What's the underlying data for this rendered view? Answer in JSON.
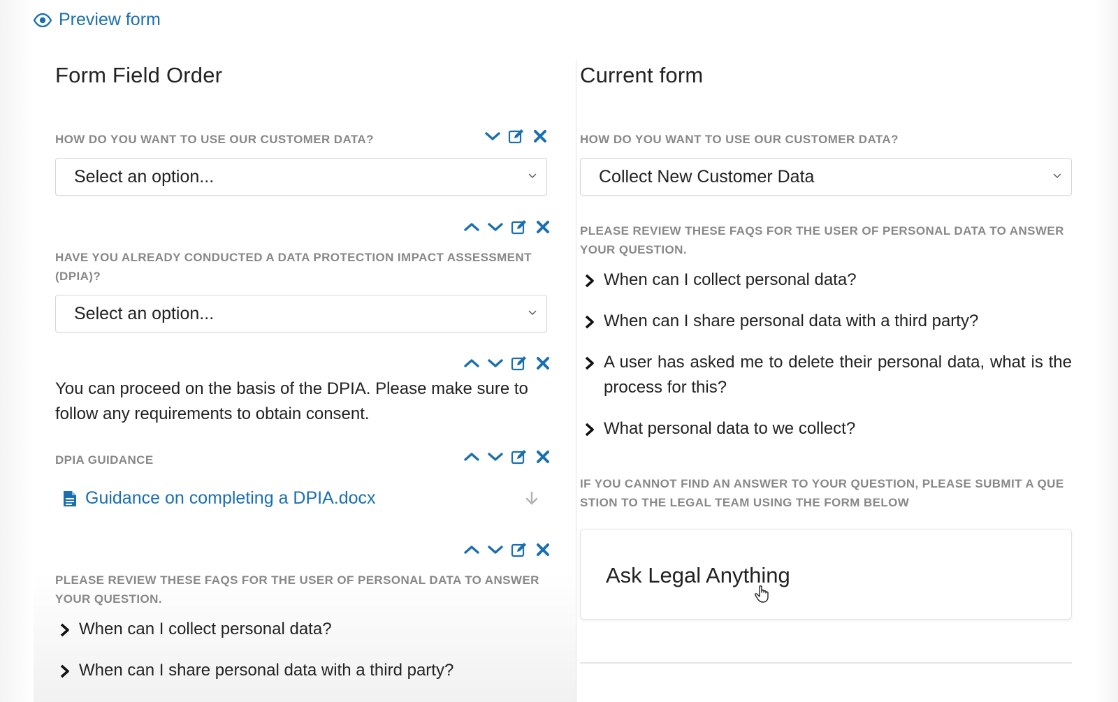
{
  "preview": {
    "label": "Preview form",
    "icon": "eye-icon"
  },
  "left": {
    "heading": "Form Field Order",
    "field1": {
      "label": "HOW DO YOU WANT TO USE OUR CUSTOMER DATA?",
      "value": "Select an option..."
    },
    "field2": {
      "label": "HAVE YOU ALREADY CONDUCTED A DATA PROTECTION IMPACT ASSESSMENT (DPIA)?",
      "value": "Select an option..."
    },
    "text_block": "You can proceed on the basis of the DPIA. Please make sure to follow any requirements to obtain consent.",
    "guidance": {
      "label": "DPIA GUIDANCE",
      "file": "Guidance on completing a DPIA.docx"
    },
    "faq_block": {
      "label": "PLEASE REVIEW THESE FAQS FOR THE USER OF PERSONAL DATA TO ANSWER YOUR QUESTION.",
      "items": [
        "When can I collect personal data?",
        "When can I share personal data with a third party?"
      ]
    }
  },
  "right": {
    "heading": "Current form",
    "field1": {
      "label": "HOW DO YOU WANT TO USE OUR CUSTOMER DATA?",
      "value": "Collect New Customer Data"
    },
    "faq_label": "PLEASE REVIEW THESE FAQS FOR THE USER OF PERSONAL DATA TO ANSWER YOUR QUESTION.",
    "faqs": [
      "When can I collect personal data?",
      "When can I share personal data with a third party?",
      "A user has asked me to delete their personal data, what is the process for this?",
      "What personal data to we collect?"
    ],
    "submit_label": "IF YOU CANNOT FIND AN ANSWER TO YOUR QUESTION, PLEASE SUBMIT A QUE STION TO THE LEGAL TEAM USING THE FORM BELOW",
    "card_title": "Ask Legal Anything"
  },
  "colors": {
    "accent": "#1a6fb0",
    "label_gray": "#888888"
  }
}
